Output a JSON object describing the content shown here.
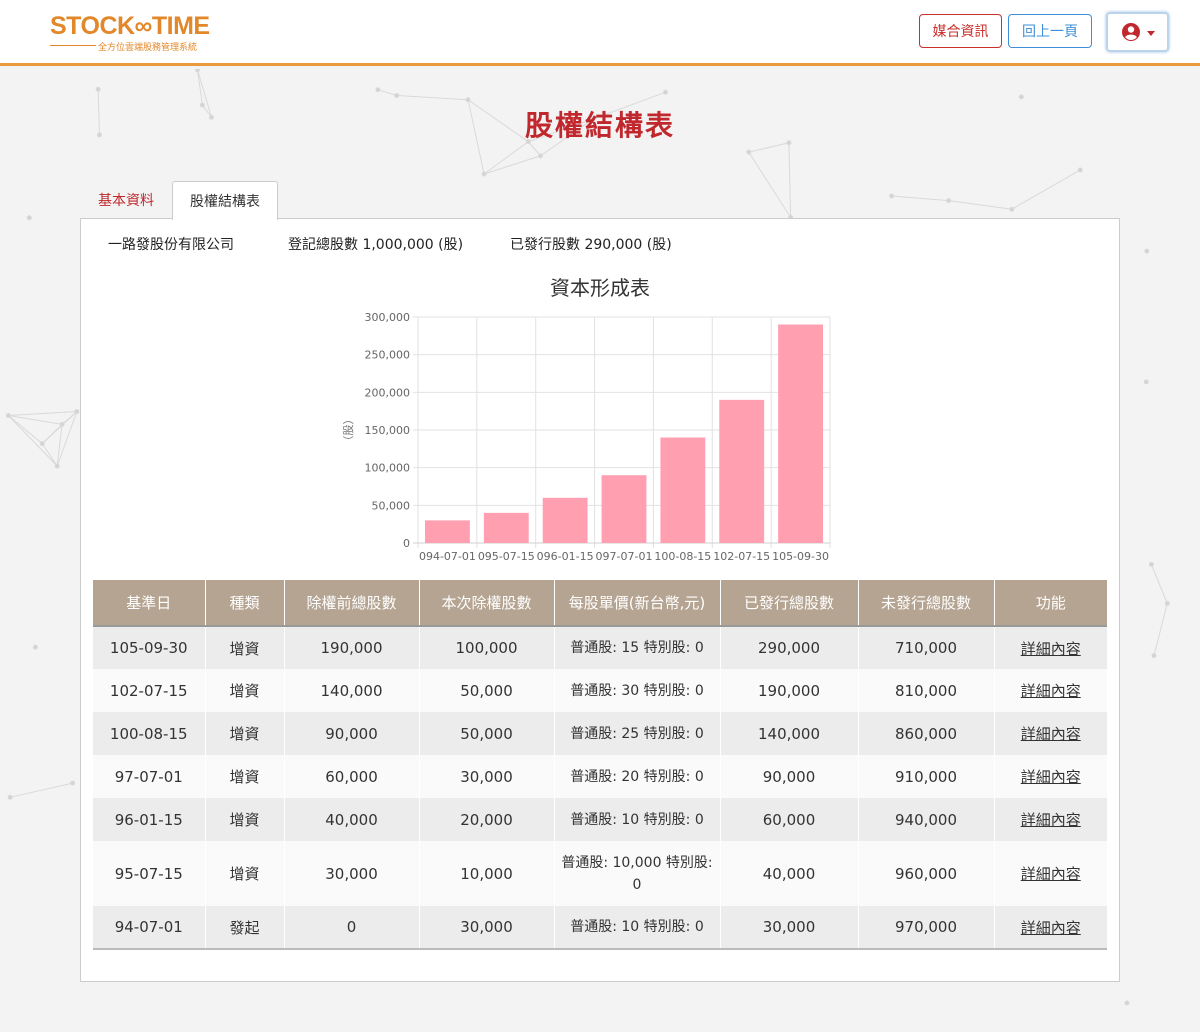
{
  "header": {
    "logo_main": "STOCK∞TIME",
    "logo_sub": "全方位雲端股務管理系統",
    "media_label": "媒合資訊",
    "back_label": "回上一頁",
    "colors": {
      "accent": "#e89a3c",
      "red": "#c0282d",
      "blue": "#3d8fd8"
    }
  },
  "page": {
    "title": "股權結構表"
  },
  "tabs": [
    {
      "label": "基本資料",
      "active": false
    },
    {
      "label": "股權結構表",
      "active": true
    }
  ],
  "info": {
    "company": "一路發股份有限公司",
    "registered": "登記總股數 1,000,000 (股)",
    "issued": "已發行股數 290,000 (股)"
  },
  "chart_data": {
    "type": "bar",
    "title": "資本形成表",
    "xlabel": "",
    "ylabel": "（股）",
    "categories": [
      "094-07-01",
      "095-07-15",
      "096-01-15",
      "097-07-01",
      "100-08-15",
      "102-07-15",
      "105-09-30"
    ],
    "values": [
      30000,
      40000,
      60000,
      90000,
      140000,
      190000,
      290000
    ],
    "ylim": [
      0,
      300000
    ],
    "yticks": [
      0,
      50000,
      100000,
      150000,
      200000,
      250000,
      300000
    ],
    "ytick_labels": [
      "0",
      "50,000",
      "100,000",
      "150,000",
      "200,000",
      "250,000",
      "300,000"
    ],
    "bar_color": "#ff9fb0",
    "grid": true,
    "legend": "none"
  },
  "table": {
    "headers": [
      "基準日",
      "種類",
      "除權前總股數",
      "本次除權股數",
      "每股單價(新台幣,元)",
      "已發行總股數",
      "未發行總股數",
      "功能"
    ],
    "rows": [
      [
        "105-09-30",
        "增資",
        "190,000",
        "100,000",
        "普通股: 15 特別股: 0",
        "290,000",
        "710,000",
        "詳細內容"
      ],
      [
        "102-07-15",
        "增資",
        "140,000",
        "50,000",
        "普通股: 30 特別股: 0",
        "190,000",
        "810,000",
        "詳細內容"
      ],
      [
        "100-08-15",
        "增資",
        "90,000",
        "50,000",
        "普通股: 25 特別股: 0",
        "140,000",
        "860,000",
        "詳細內容"
      ],
      [
        "97-07-01",
        "增資",
        "60,000",
        "30,000",
        "普通股: 20 特別股: 0",
        "90,000",
        "910,000",
        "詳細內容"
      ],
      [
        "96-01-15",
        "增資",
        "40,000",
        "20,000",
        "普通股: 10 特別股: 0",
        "60,000",
        "940,000",
        "詳細內容"
      ],
      [
        "95-07-15",
        "增資",
        "30,000",
        "10,000",
        "普通股: 10,000 特別股: 0",
        "40,000",
        "960,000",
        "詳細內容"
      ],
      [
        "94-07-01",
        "發起",
        "0",
        "30,000",
        "普通股: 10 特別股: 0",
        "30,000",
        "970,000",
        "詳細內容"
      ]
    ]
  }
}
